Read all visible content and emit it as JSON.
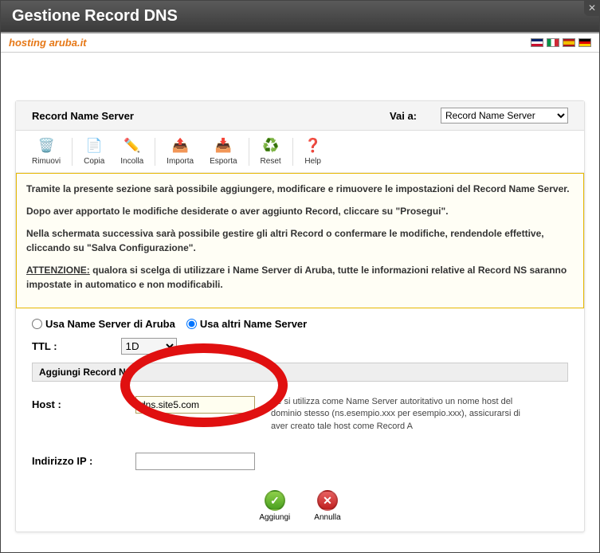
{
  "window": {
    "title": "Gestione Record DNS"
  },
  "branding": {
    "hosting": "hosting",
    "aruba": "aruba.it"
  },
  "panel": {
    "title": "Record Name Server",
    "goto_label": "Vai a:",
    "goto_selected": "Record Name Server"
  },
  "toolbar": {
    "remove": "Rimuovi",
    "copy": "Copia",
    "paste": "Incolla",
    "import": "Importa",
    "export": "Esporta",
    "reset": "Reset",
    "help": "Help"
  },
  "info": {
    "p1": "Tramite la presente sezione sarà possibile aggiungere, modificare e rimuovere le impostazioni del Record Name Server.",
    "p2a": "Dopo aver apportato le modifiche desiderate o aver aggiunto Record, cliccare su ",
    "p2b": "\"Prosegui\"",
    "p2c": ".",
    "p3a": "Nella schermata successiva sarà possibile gestire gli altri Record o confermare le modifiche, rendendole effettive, cliccando su ",
    "p3b": "\"Salva Configurazione\"",
    "p3c": ".",
    "attn_label": "ATTENZIONE:",
    "attn_text": " qualora si scelga di utilizzare i Name Server di Aruba, tutte le informazioni relative al Record NS saranno impostate in automatico e non modificabili."
  },
  "form": {
    "radio_aruba": "Usa Name Server di Aruba",
    "radio_other": "Usa altri Name Server",
    "ttl_label": "TTL :",
    "ttl_value": "1D",
    "section_header": "Aggiungi Record NS",
    "host_label": "Host :",
    "host_value": "dns.site5.com",
    "host_help": "Se si utilizza come Name Server autoritativo un nome host del dominio stesso (ns.esempio.xxx per esempio.xxx), assicurarsi di aver creato tale host come Record A",
    "ip_label": "Indirizzo IP :",
    "ip_value": ""
  },
  "actions": {
    "add": "Aggiungi",
    "cancel": "Annulla"
  }
}
